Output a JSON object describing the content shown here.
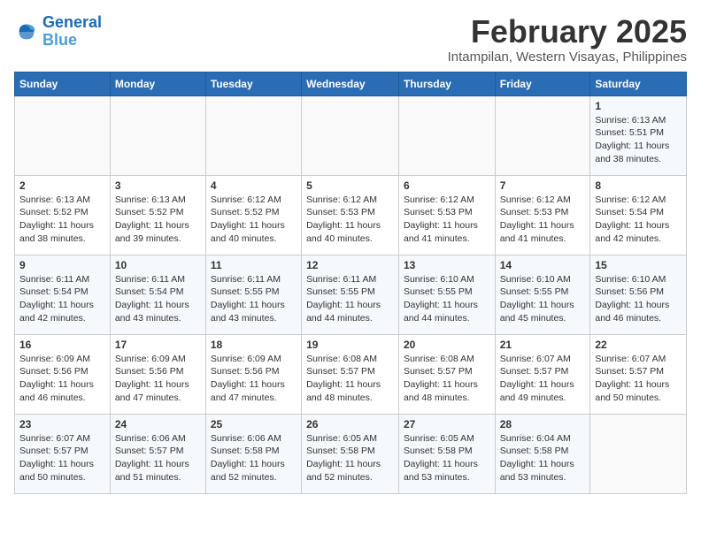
{
  "header": {
    "logo_line1": "General",
    "logo_line2": "Blue",
    "title": "February 2025",
    "subtitle": "Intampilan, Western Visayas, Philippines"
  },
  "days_of_week": [
    "Sunday",
    "Monday",
    "Tuesday",
    "Wednesday",
    "Thursday",
    "Friday",
    "Saturday"
  ],
  "weeks": [
    [
      {
        "day": "",
        "info": ""
      },
      {
        "day": "",
        "info": ""
      },
      {
        "day": "",
        "info": ""
      },
      {
        "day": "",
        "info": ""
      },
      {
        "day": "",
        "info": ""
      },
      {
        "day": "",
        "info": ""
      },
      {
        "day": "1",
        "info": "Sunrise: 6:13 AM\nSunset: 5:51 PM\nDaylight: 11 hours and 38 minutes."
      }
    ],
    [
      {
        "day": "2",
        "info": "Sunrise: 6:13 AM\nSunset: 5:52 PM\nDaylight: 11 hours and 38 minutes."
      },
      {
        "day": "3",
        "info": "Sunrise: 6:13 AM\nSunset: 5:52 PM\nDaylight: 11 hours and 39 minutes."
      },
      {
        "day": "4",
        "info": "Sunrise: 6:12 AM\nSunset: 5:52 PM\nDaylight: 11 hours and 40 minutes."
      },
      {
        "day": "5",
        "info": "Sunrise: 6:12 AM\nSunset: 5:53 PM\nDaylight: 11 hours and 40 minutes."
      },
      {
        "day": "6",
        "info": "Sunrise: 6:12 AM\nSunset: 5:53 PM\nDaylight: 11 hours and 41 minutes."
      },
      {
        "day": "7",
        "info": "Sunrise: 6:12 AM\nSunset: 5:53 PM\nDaylight: 11 hours and 41 minutes."
      },
      {
        "day": "8",
        "info": "Sunrise: 6:12 AM\nSunset: 5:54 PM\nDaylight: 11 hours and 42 minutes."
      }
    ],
    [
      {
        "day": "9",
        "info": "Sunrise: 6:11 AM\nSunset: 5:54 PM\nDaylight: 11 hours and 42 minutes."
      },
      {
        "day": "10",
        "info": "Sunrise: 6:11 AM\nSunset: 5:54 PM\nDaylight: 11 hours and 43 minutes."
      },
      {
        "day": "11",
        "info": "Sunrise: 6:11 AM\nSunset: 5:55 PM\nDaylight: 11 hours and 43 minutes."
      },
      {
        "day": "12",
        "info": "Sunrise: 6:11 AM\nSunset: 5:55 PM\nDaylight: 11 hours and 44 minutes."
      },
      {
        "day": "13",
        "info": "Sunrise: 6:10 AM\nSunset: 5:55 PM\nDaylight: 11 hours and 44 minutes."
      },
      {
        "day": "14",
        "info": "Sunrise: 6:10 AM\nSunset: 5:55 PM\nDaylight: 11 hours and 45 minutes."
      },
      {
        "day": "15",
        "info": "Sunrise: 6:10 AM\nSunset: 5:56 PM\nDaylight: 11 hours and 46 minutes."
      }
    ],
    [
      {
        "day": "16",
        "info": "Sunrise: 6:09 AM\nSunset: 5:56 PM\nDaylight: 11 hours and 46 minutes."
      },
      {
        "day": "17",
        "info": "Sunrise: 6:09 AM\nSunset: 5:56 PM\nDaylight: 11 hours and 47 minutes."
      },
      {
        "day": "18",
        "info": "Sunrise: 6:09 AM\nSunset: 5:56 PM\nDaylight: 11 hours and 47 minutes."
      },
      {
        "day": "19",
        "info": "Sunrise: 6:08 AM\nSunset: 5:57 PM\nDaylight: 11 hours and 48 minutes."
      },
      {
        "day": "20",
        "info": "Sunrise: 6:08 AM\nSunset: 5:57 PM\nDaylight: 11 hours and 48 minutes."
      },
      {
        "day": "21",
        "info": "Sunrise: 6:07 AM\nSunset: 5:57 PM\nDaylight: 11 hours and 49 minutes."
      },
      {
        "day": "22",
        "info": "Sunrise: 6:07 AM\nSunset: 5:57 PM\nDaylight: 11 hours and 50 minutes."
      }
    ],
    [
      {
        "day": "23",
        "info": "Sunrise: 6:07 AM\nSunset: 5:57 PM\nDaylight: 11 hours and 50 minutes."
      },
      {
        "day": "24",
        "info": "Sunrise: 6:06 AM\nSunset: 5:57 PM\nDaylight: 11 hours and 51 minutes."
      },
      {
        "day": "25",
        "info": "Sunrise: 6:06 AM\nSunset: 5:58 PM\nDaylight: 11 hours and 52 minutes."
      },
      {
        "day": "26",
        "info": "Sunrise: 6:05 AM\nSunset: 5:58 PM\nDaylight: 11 hours and 52 minutes."
      },
      {
        "day": "27",
        "info": "Sunrise: 6:05 AM\nSunset: 5:58 PM\nDaylight: 11 hours and 53 minutes."
      },
      {
        "day": "28",
        "info": "Sunrise: 6:04 AM\nSunset: 5:58 PM\nDaylight: 11 hours and 53 minutes."
      },
      {
        "day": "",
        "info": ""
      }
    ]
  ]
}
